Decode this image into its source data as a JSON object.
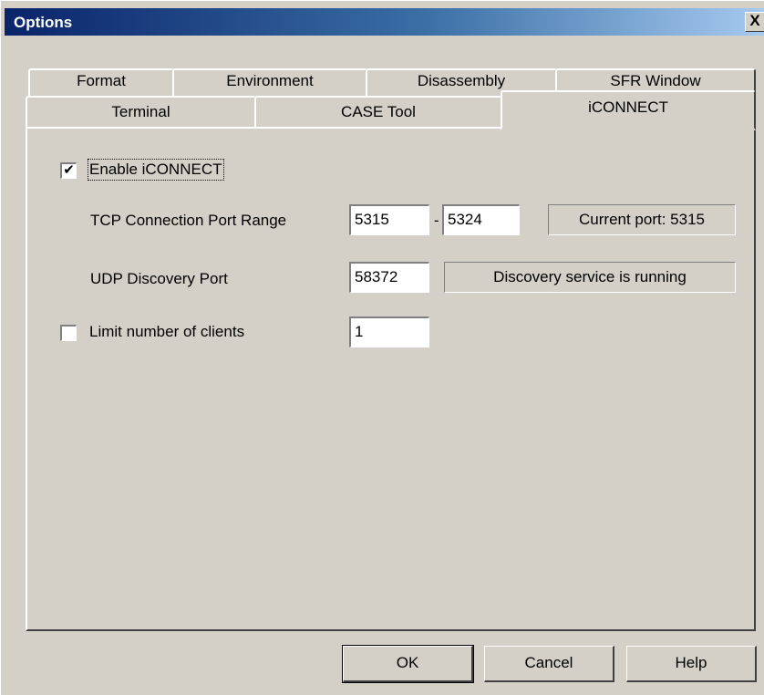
{
  "window": {
    "title": "Options",
    "close_label": "X"
  },
  "tabs": {
    "row_back": [
      "Format",
      "Environment",
      "Disassembly",
      "SFR Window"
    ],
    "row_front": [
      "Terminal",
      "CASE Tool",
      "iCONNECT"
    ],
    "active": "iCONNECT"
  },
  "iconnect": {
    "enable_label": "Enable iCONNECT",
    "enable_checked": "✔",
    "tcp_label": "TCP Connection Port Range",
    "tcp_from": "5315",
    "range_dash": "-",
    "tcp_to": "5324",
    "current_port": "Current port: 5315",
    "udp_label": "UDP Discovery Port",
    "udp_port": "58372",
    "discovery_status": "Discovery service is running",
    "limit_label": "Limit number of clients",
    "limit_checked": "",
    "limit_value": "1"
  },
  "buttons": {
    "ok": "OK",
    "cancel": "Cancel",
    "help": "Help"
  }
}
